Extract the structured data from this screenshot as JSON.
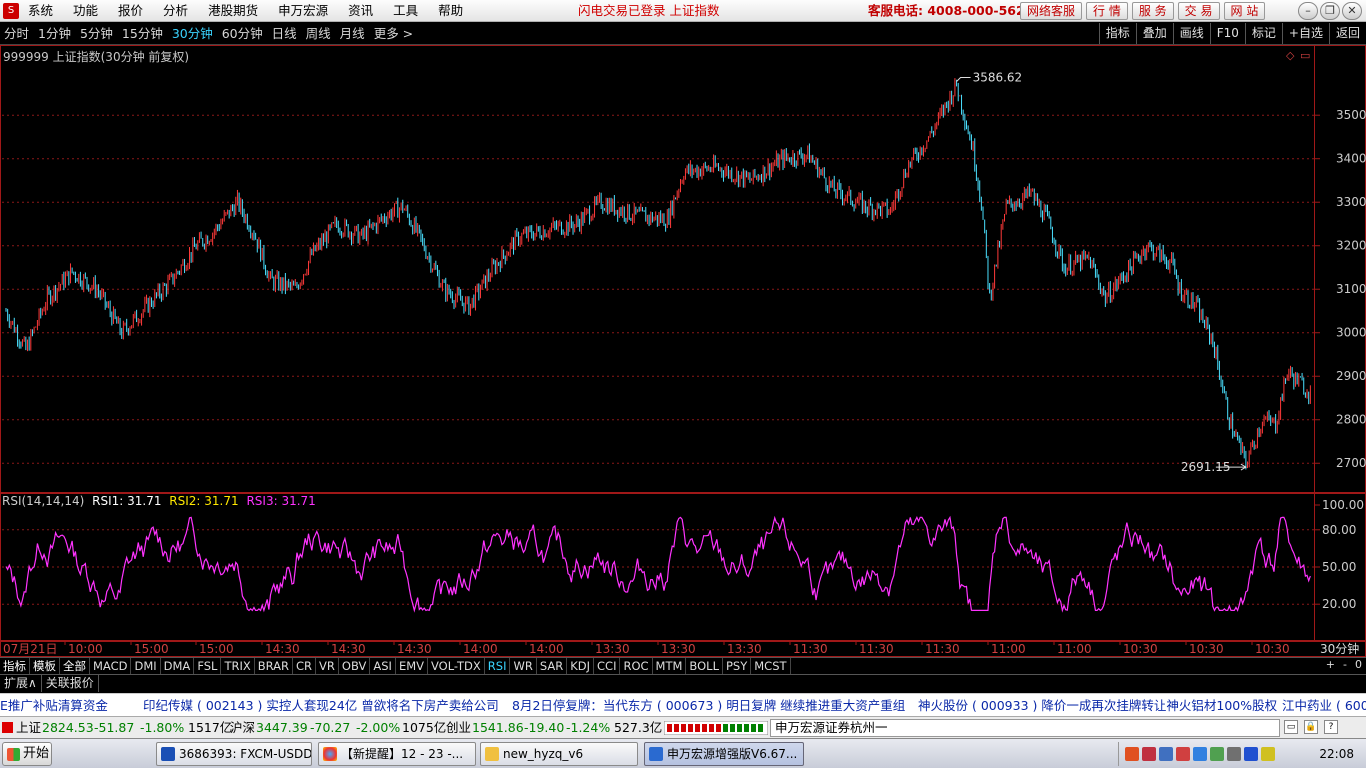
{
  "menu": {
    "items": [
      "系统",
      "功能",
      "报价",
      "分析",
      "港股期货",
      "申万宏源",
      "资讯",
      "工具",
      "帮助"
    ],
    "notice": "闪电交易已登录   上证指数",
    "hotline": "客服电话: 4008-000-562",
    "quick_buttons": [
      "网络客服",
      "行 情",
      "服 务",
      "交 易",
      "网 站"
    ]
  },
  "periods": {
    "items": [
      "分时",
      "1分钟",
      "5分钟",
      "15分钟",
      "30分钟",
      "60分钟",
      "日线",
      "周线",
      "月线",
      "更多 >"
    ],
    "active": "30分钟"
  },
  "tools": [
    "指标",
    "叠加",
    "画线",
    "F10",
    "标记",
    "+自选",
    "返回"
  ],
  "main_chart": {
    "title": "999999 上证指数(30分钟 前复权)",
    "high_label": "3586.62",
    "low_label": "2691.15",
    "yticks": [
      "3500",
      "3400",
      "3300",
      "3200",
      "3100",
      "3000",
      "2900",
      "2800",
      "2700"
    ]
  },
  "rsi_chart": {
    "title": "RSI(14,14,14)",
    "rsi1_label": "RSI1: 31.71",
    "rsi2_label": "RSI2: 31.71",
    "rsi3_label": "RSI3: 31.71",
    "yticks": [
      "100.00",
      "80.00",
      "50.00",
      "20.00"
    ]
  },
  "time_axis": {
    "labels": [
      "07月21日",
      "10:00",
      "15:00",
      "15:00",
      "14:30",
      "14:30",
      "14:30",
      "14:00",
      "14:00",
      "13:30",
      "13:30",
      "13:30",
      "11:30",
      "11:30",
      "11:30",
      "11:00",
      "11:00",
      "10:30",
      "10:30",
      "10:30"
    ],
    "period": "30分钟"
  },
  "indicator_tabs": {
    "items": [
      "指标",
      "模板",
      "全部",
      "MACD",
      "DMI",
      "DMA",
      "FSL",
      "TRIX",
      "BRAR",
      "CR",
      "VR",
      "OBV",
      "ASI",
      "EMV",
      "VOL-TDX",
      "RSI",
      "WR",
      "SAR",
      "KDJ",
      "CCI",
      "ROC",
      "MTM",
      "BOLL",
      "PSY",
      "MCST"
    ],
    "active": "RSI",
    "controls": [
      "+",
      "-",
      "0"
    ]
  },
  "ext_tabs": [
    "扩展∧",
    "关联报价"
  ],
  "ticker": [
    "E推广补贴清算资金",
    "印纪传媒 ( 002143 ) 实控人套现24亿  曾欲将名下房产卖给公司",
    "8月2日停复牌：当代东方 ( 000673 ) 明日复牌  继续推进重大资产重组",
    "神火股份 ( 000933 ) 降价一成再次挂牌转让神火铝材100%股权",
    "江中药业 ( 600"
  ],
  "market": {
    "sh": {
      "name": "上证",
      "price": "2824.53",
      "chg": "-51.87",
      "pct": "-1.80%",
      "amt": "1517亿"
    },
    "hs": {
      "name": "沪深",
      "price": "3447.39",
      "chg": "-70.27",
      "pct": "-2.00%",
      "amt": "1075亿"
    },
    "cy": {
      "name": "创业",
      "price": "1541.86",
      "chg": "-19.40",
      "pct": "-1.24%",
      "amt": "527.3亿"
    },
    "broker": "申万宏源证券杭州一"
  },
  "taskbar": {
    "start": "开始",
    "tasks": [
      "3686393: FXCM-USDDe...",
      "【新提醒】12 - 23 -...",
      "new_hyzq_v6",
      "申万宏源增强版V6.67..."
    ],
    "clock": "22:08"
  },
  "colors": {
    "up": "#ff3a3a",
    "down": "#4ae0ff",
    "rsi": "#ff33ff",
    "grid": "#8a1818",
    "frame": "#a01818"
  },
  "chart_data": [
    {
      "type": "candlestick",
      "title": "999999 上证指数(30分钟 前复权)",
      "ylim": [
        2650,
        3620
      ],
      "annotations": [
        {
          "text": "3586.62",
          "value": 3586.62
        },
        {
          "text": "2691.15",
          "value": 2691.15
        }
      ],
      "trend": [
        [
          0,
          3050
        ],
        [
          12,
          2960
        ],
        [
          25,
          3080
        ],
        [
          40,
          3140
        ],
        [
          55,
          3100
        ],
        [
          70,
          3000
        ],
        [
          85,
          3060
        ],
        [
          100,
          3120
        ],
        [
          115,
          3200
        ],
        [
          125,
          3230
        ],
        [
          140,
          3300
        ],
        [
          150,
          3230
        ],
        [
          160,
          3120
        ],
        [
          175,
          3100
        ],
        [
          185,
          3180
        ],
        [
          200,
          3250
        ],
        [
          215,
          3220
        ],
        [
          230,
          3270
        ],
        [
          240,
          3290
        ],
        [
          250,
          3220
        ],
        [
          265,
          3100
        ],
        [
          280,
          3060
        ],
        [
          295,
          3150
        ],
        [
          310,
          3220
        ],
        [
          330,
          3240
        ],
        [
          345,
          3250
        ],
        [
          360,
          3300
        ],
        [
          380,
          3270
        ],
        [
          400,
          3260
        ],
        [
          410,
          3370
        ],
        [
          430,
          3380
        ],
        [
          450,
          3350
        ],
        [
          470,
          3400
        ],
        [
          485,
          3410
        ],
        [
          500,
          3330
        ],
        [
          520,
          3290
        ],
        [
          535,
          3280
        ],
        [
          545,
          3380
        ],
        [
          560,
          3460
        ],
        [
          575,
          3570
        ],
        [
          585,
          3420
        ],
        [
          590,
          3300
        ],
        [
          595,
          3080
        ],
        [
          605,
          3290
        ],
        [
          620,
          3320
        ],
        [
          630,
          3260
        ],
        [
          640,
          3150
        ],
        [
          655,
          3170
        ],
        [
          665,
          3080
        ],
        [
          680,
          3150
        ],
        [
          690,
          3200
        ],
        [
          705,
          3160
        ],
        [
          710,
          3100
        ],
        [
          720,
          3060
        ],
        [
          730,
          2980
        ],
        [
          740,
          2800
        ],
        [
          750,
          2700
        ],
        [
          760,
          2800
        ],
        [
          768,
          2790
        ],
        [
          775,
          2910
        ],
        [
          790,
          2860
        ]
      ],
      "n_bars": 790
    },
    {
      "type": "line",
      "title": "RSI(14,14,14)",
      "ylim": [
        0,
        100
      ],
      "yticks": [
        20,
        50,
        80,
        100
      ],
      "series": [
        {
          "name": "RSI1",
          "last": 31.71
        },
        {
          "name": "RSI2",
          "last": 31.71
        },
        {
          "name": "RSI3",
          "last": 31.71
        }
      ]
    }
  ]
}
